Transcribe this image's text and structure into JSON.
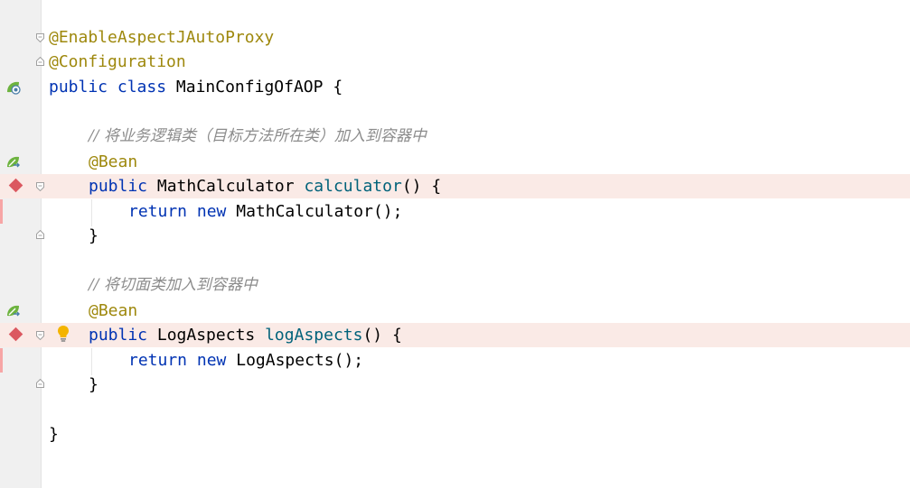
{
  "editor": {
    "lines": [
      {
        "annotation": "@EnableAspectJAutoProxy"
      },
      {
        "annotation": "@Configuration"
      },
      {
        "kw1": "public",
        "kw2": "class",
        "name": "MainConfigOfAOP",
        "brace": "{"
      },
      {},
      {
        "comment": "// 将业务逻辑类（目标方法所在类）加入到容器中"
      },
      {
        "annotation": "@Bean"
      },
      {
        "kw": "public",
        "type": "MathCalculator",
        "method": "calculator",
        "rest": "() {"
      },
      {
        "kw1": "return",
        "kw2": "new",
        "rest": "MathCalculator();"
      },
      {
        "rest": "}"
      },
      {},
      {
        "comment": "// 将切面类加入到容器中"
      },
      {
        "annotation": "@Bean"
      },
      {
        "kw": "public",
        "type": "LogAspects",
        "method": "logAspects",
        "rest": "() {"
      },
      {
        "kw1": "return",
        "kw2": "new",
        "rest": "LogAspects();"
      },
      {
        "rest": "}"
      },
      {},
      {
        "rest": "}"
      }
    ]
  },
  "colors": {
    "keyword": "#0033b3",
    "annotation": "#9e880d",
    "method": "#00627a",
    "comment": "#8c8c8c",
    "breakpoint": "#db5860",
    "highlight": "#faeae6",
    "gutter": "#f0f0f0"
  },
  "icons": {
    "class_gutter": "spring-config-icon",
    "bean_gutter": "spring-bean-icon",
    "breakpoint": "breakpoint-icon",
    "fold": "fold-marker-icon",
    "intention": "lightbulb-icon"
  }
}
